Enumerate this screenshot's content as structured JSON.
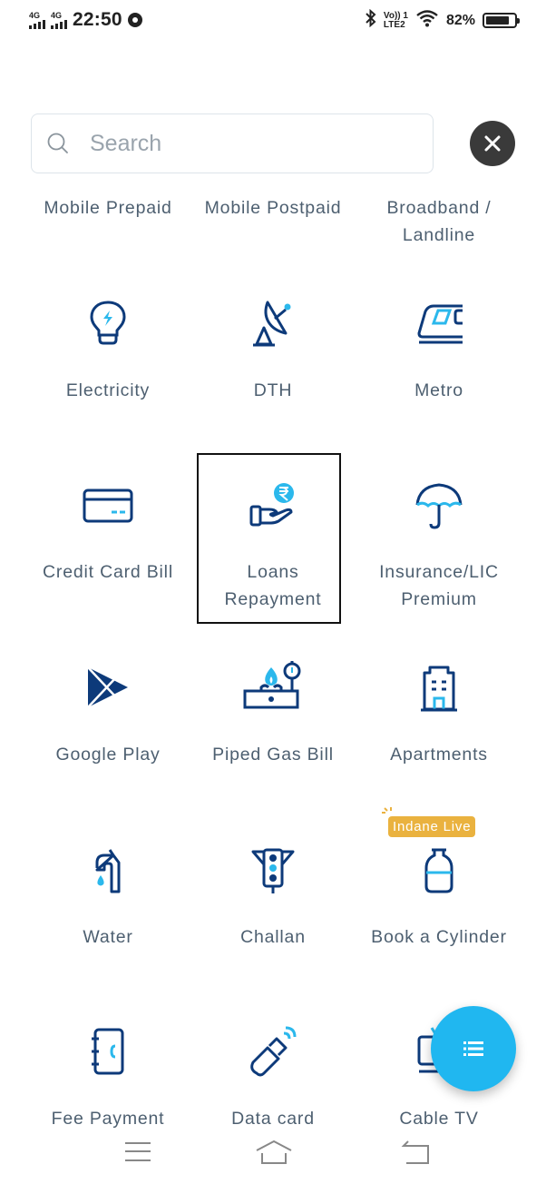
{
  "status_bar": {
    "sim1_network": "4G",
    "sim2_network": "4G",
    "time": "22:50",
    "volte_top": "Vo)) 1",
    "volte_bottom": "LTE2",
    "battery_percent_label": "82%",
    "battery_level": 0.82,
    "icons": [
      "signal-icon",
      "signal-icon",
      "chrome-icon",
      "bluetooth-icon",
      "volte-icon",
      "wifi-icon",
      "battery-icon"
    ]
  },
  "search": {
    "placeholder": "Search",
    "value": "",
    "icon": "search-icon"
  },
  "close_button": {
    "icon": "close-icon"
  },
  "categories": [
    {
      "label": "Mobile Prepaid",
      "icon": "mobile-prepaid-icon"
    },
    {
      "label": "Mobile Postpaid",
      "icon": "mobile-postpaid-icon"
    },
    {
      "label": "Broadband / Landline",
      "icon": "broadband-icon"
    },
    {
      "label": "Electricity",
      "icon": "bulb-icon"
    },
    {
      "label": "DTH",
      "icon": "satellite-dish-icon"
    },
    {
      "label": "Metro",
      "icon": "metro-train-icon"
    },
    {
      "label": "Credit Card Bill",
      "icon": "credit-card-icon"
    },
    {
      "label": "Loans Repayment",
      "icon": "rupee-hand-icon",
      "selected": true
    },
    {
      "label": "Insurance/LIC Premium",
      "icon": "umbrella-icon"
    },
    {
      "label": "Google Play",
      "icon": "google-play-icon"
    },
    {
      "label": "Piped Gas Bill",
      "icon": "gas-stove-icon"
    },
    {
      "label": "Apartments",
      "icon": "building-icon"
    },
    {
      "label": "Water",
      "icon": "water-tap-icon"
    },
    {
      "label": "Challan",
      "icon": "traffic-light-icon"
    },
    {
      "label": "Book a Cylinder",
      "icon": "gas-cylinder-icon",
      "badge": "Indane Live"
    },
    {
      "label": "Fee Payment",
      "icon": "notebook-icon"
    },
    {
      "label": "Data card",
      "icon": "usb-dongle-icon"
    },
    {
      "label": "Cable TV",
      "icon": "tv-icon"
    }
  ],
  "fab": {
    "icon": "list-icon"
  },
  "nav_bar": {
    "buttons": [
      {
        "name": "menu",
        "icon": "menu-icon"
      },
      {
        "name": "home",
        "icon": "home-icon"
      },
      {
        "name": "back",
        "icon": "back-icon"
      }
    ]
  },
  "colors": {
    "icon_dark": "#0d3a7a",
    "icon_accent": "#2bb8ec",
    "label_text": "#4d5f70",
    "fab": "#20b7f0",
    "badge": "#eab23f",
    "close_button": "#3a3a3a"
  }
}
